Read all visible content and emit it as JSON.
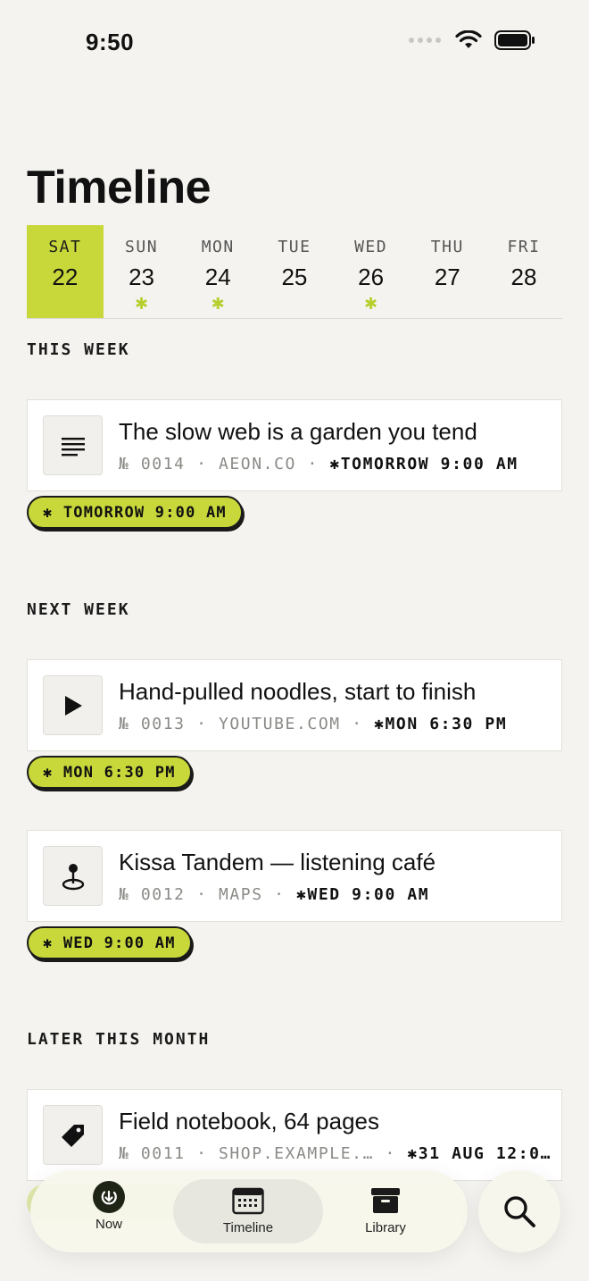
{
  "status": {
    "time": "9:50"
  },
  "page_title": "Timeline",
  "week": [
    {
      "name": "SAT",
      "num": "22",
      "selected": true,
      "dot": false
    },
    {
      "name": "SUN",
      "num": "23",
      "selected": false,
      "dot": true
    },
    {
      "name": "MON",
      "num": "24",
      "selected": false,
      "dot": true
    },
    {
      "name": "TUE",
      "num": "25",
      "selected": false,
      "dot": false
    },
    {
      "name": "WED",
      "num": "26",
      "selected": false,
      "dot": true
    },
    {
      "name": "THU",
      "num": "27",
      "selected": false,
      "dot": false
    },
    {
      "name": "FRI",
      "num": "28",
      "selected": false,
      "dot": false
    }
  ],
  "day_marker": "✱",
  "sections": {
    "this_week": "THIS WEEK",
    "next_week": "NEXT WEEK",
    "later": "LATER THIS MONTH"
  },
  "items": [
    {
      "icon": "article-icon",
      "title": "The slow web is a garden you tend",
      "number": "№ 0014",
      "source": "AEON.CO",
      "schedule": "✱TOMORROW 9:00 AM",
      "pill": "✱ TOMORROW 9:00 AM"
    },
    {
      "icon": "play-icon",
      "title": "Hand-pulled noodles, start to finish",
      "number": "№ 0013",
      "source": "YOUTUBE.COM",
      "schedule": "✱MON 6:30 PM",
      "pill": "✱ MON 6:30 PM"
    },
    {
      "icon": "map-pin-icon",
      "title": "Kissa Tandem — listening café",
      "number": "№ 0012",
      "source": "MAPS",
      "schedule": "✱WED 9:00 AM",
      "pill": "✱ WED 9:00 AM"
    },
    {
      "icon": "tag-icon",
      "title": "Field notebook, 64 pages",
      "number": "№ 0011",
      "source": "SHOP.EXAMPLE.…",
      "schedule": "✱31 AUG 12:0…"
    }
  ],
  "meta_separator": "·",
  "tabs": [
    {
      "label": "Now",
      "icon": "now-icon"
    },
    {
      "label": "Timeline",
      "icon": "calendar-icon"
    },
    {
      "label": "Library",
      "icon": "archive-icon"
    }
  ],
  "colors": {
    "accent": "#c8d83a",
    "background": "#f4f3ef",
    "ink": "#111111"
  }
}
